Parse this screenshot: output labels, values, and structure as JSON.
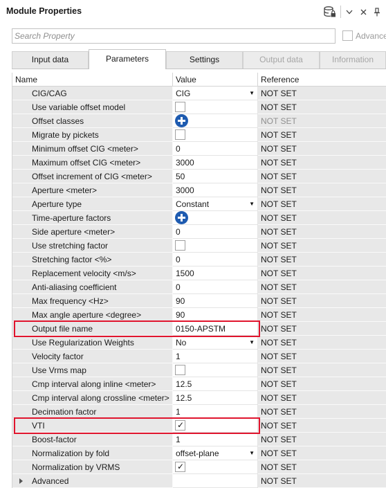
{
  "panel": {
    "title": "Module Properties"
  },
  "search": {
    "placeholder": "Search Property",
    "value": ""
  },
  "advanced_toggle": {
    "label": "Advance",
    "checked": false
  },
  "tabs": [
    {
      "label": "Input data",
      "active": false,
      "disabled": false
    },
    {
      "label": "Parameters",
      "active": true,
      "disabled": false
    },
    {
      "label": "Settings",
      "active": false,
      "disabled": false
    },
    {
      "label": "Output data",
      "active": false,
      "disabled": true
    },
    {
      "label": "Information",
      "active": false,
      "disabled": true
    }
  ],
  "grid": {
    "columns": [
      "Name",
      "Value",
      "Reference"
    ],
    "rows": [
      {
        "name": "CIG/CAG",
        "type": "dropdown",
        "value": "CIG",
        "ref": "NOT SET"
      },
      {
        "name": "Use variable offset model",
        "type": "checkbox",
        "checked": false,
        "ref": "NOT SET"
      },
      {
        "name": "Offset classes",
        "type": "add",
        "ref": "NOT SET",
        "ref_dim": true
      },
      {
        "name": "Migrate by pickets",
        "type": "checkbox",
        "checked": false,
        "ref": "NOT SET"
      },
      {
        "name": "Minimum offset CIG <meter>",
        "type": "text",
        "value": "0",
        "ref": "NOT SET"
      },
      {
        "name": "Maximum offset CIG <meter>",
        "type": "text",
        "value": "3000",
        "ref": "NOT SET"
      },
      {
        "name": "Offset increment of CIG <meter>",
        "type": "text",
        "value": "50",
        "ref": "NOT SET"
      },
      {
        "name": "Aperture <meter>",
        "type": "text",
        "value": "3000",
        "ref": "NOT SET"
      },
      {
        "name": "Aperture type",
        "type": "dropdown",
        "value": "Constant",
        "ref": "NOT SET"
      },
      {
        "name": "Time-aperture factors",
        "type": "add",
        "ref": "NOT SET"
      },
      {
        "name": "Side aperture <meter>",
        "type": "text",
        "value": "0",
        "ref": "NOT SET"
      },
      {
        "name": "Use stretching factor",
        "type": "checkbox",
        "checked": false,
        "ref": "NOT SET"
      },
      {
        "name": "Stretching factor <%>",
        "type": "text",
        "value": "0",
        "ref": "NOT SET"
      },
      {
        "name": "Replacement velocity <m/s>",
        "type": "text",
        "value": "1500",
        "ref": "NOT SET"
      },
      {
        "name": "Anti-aliasing coefficient",
        "type": "text",
        "value": "0",
        "ref": "NOT SET"
      },
      {
        "name": "Max frequency <Hz>",
        "type": "text",
        "value": "90",
        "ref": "NOT SET"
      },
      {
        "name": "Max angle aperture <degree>",
        "type": "text",
        "value": "90",
        "ref": "NOT SET"
      },
      {
        "name": "Output file name",
        "type": "text",
        "value": "0150-APSTM",
        "ref": "NOT SET",
        "highlight": true
      },
      {
        "name": "Use Regularization Weights",
        "type": "dropdown",
        "value": "No",
        "ref": "NOT SET"
      },
      {
        "name": "Velocity factor",
        "type": "text",
        "value": "1",
        "ref": "NOT SET"
      },
      {
        "name": "Use Vrms map",
        "type": "checkbox",
        "checked": false,
        "ref": "NOT SET"
      },
      {
        "name": "Cmp interval along inline <meter>",
        "type": "text",
        "value": "12.5",
        "ref": "NOT SET"
      },
      {
        "name": "Cmp interval along crossline <meter>",
        "type": "text",
        "value": "12.5",
        "ref": "NOT SET"
      },
      {
        "name": "Decimation factor",
        "type": "text",
        "value": "1",
        "ref": "NOT SET"
      },
      {
        "name": "VTI",
        "type": "checkbox",
        "checked": true,
        "ref": "NOT SET",
        "highlight": true
      },
      {
        "name": "Boost-factor",
        "type": "text",
        "value": "1",
        "ref": "NOT SET"
      },
      {
        "name": "Normalization by fold",
        "type": "dropdown",
        "value": "offset-plane",
        "ref": "NOT SET"
      },
      {
        "name": "Normalization by VRMS",
        "type": "checkbox",
        "checked": true,
        "ref": "NOT SET"
      },
      {
        "name": "Advanced",
        "type": "group",
        "ref": "NOT SET"
      }
    ]
  },
  "colors": {
    "highlight": "#e0142d",
    "accent_icon": "#1e5bb0",
    "name_bg": "#e8e8e8"
  },
  "icons": [
    "database-lock-icon",
    "chevron-down-icon",
    "close-icon",
    "pin-icon",
    "add-icon",
    "checkmark-icon",
    "dropdown-arrow-icon",
    "expand-arrow-icon"
  ]
}
